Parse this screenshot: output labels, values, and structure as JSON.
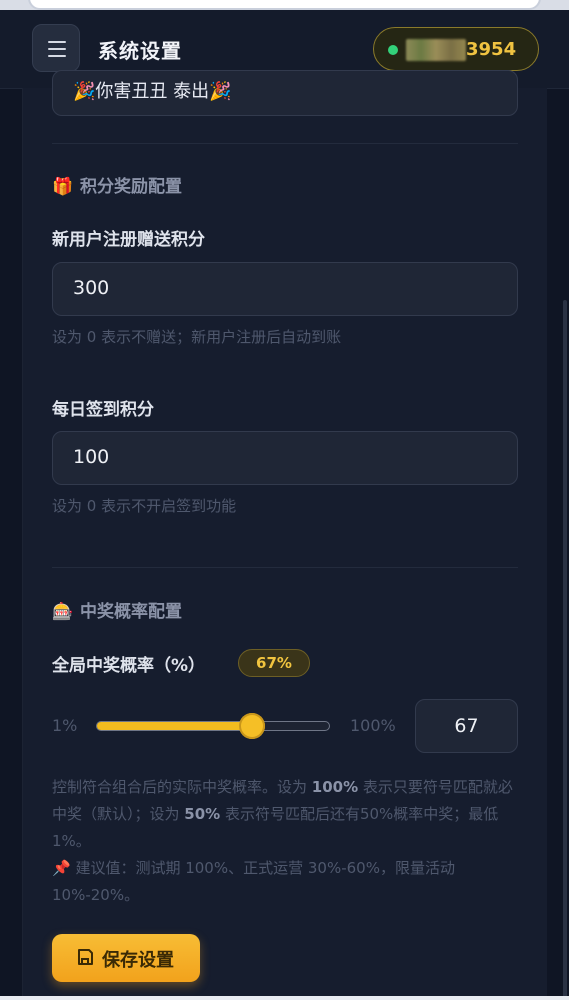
{
  "header": {
    "title": "系统设置",
    "user_id_suffix": "3954",
    "online_color": "#33d17a"
  },
  "previous_field": {
    "value": "🎉你害丑丑 泰出🎉"
  },
  "points_section": {
    "icon": "gift-icon",
    "title": "积分奖励配置",
    "register_label": "新用户注册赠送积分",
    "register_value": "300",
    "register_hint": "设为 0 表示不赠送；新用户注册后自动到账",
    "checkin_label": "每日签到积分",
    "checkin_value": "100",
    "checkin_hint": "设为 0 表示不开启签到功能"
  },
  "prob_section": {
    "icon": "slot-machine-icon",
    "title": "中奖概率配置",
    "rate_label": "全局中奖概率（%）",
    "rate_badge": "67%",
    "slider_min": "1%",
    "slider_max": "100%",
    "slider_value": 67,
    "input_value": "67",
    "desc_1": "控制符合组合后的实际中奖概率。设为 ",
    "desc_b1": "100%",
    "desc_2": " 表示只要符号匹配就必中奖（默认）；设为 ",
    "desc_b2": "50%",
    "desc_3": " 表示符号匹配后还有50%概率中奖；最低 1%。",
    "tip": "📌 建议值：测试期 100%、正式运营 30%-60%，限量活动 10%-20%。"
  },
  "actions": {
    "save_label": "保存设置"
  },
  "colors": {
    "accent": "#f3bc1f",
    "background": "#0f1524",
    "card": "#161d2e"
  }
}
